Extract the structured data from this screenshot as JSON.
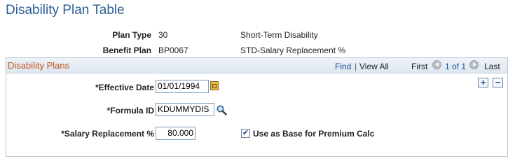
{
  "page": {
    "title": "Disability Plan Table"
  },
  "header": {
    "plan_type": {
      "label": "Plan Type",
      "code": "30",
      "description": "Short-Term Disability"
    },
    "benefit_plan": {
      "label": "Benefit Plan",
      "code": "BP0067",
      "description": "STD-Salary Replacement %"
    }
  },
  "section": {
    "title": "Disability Plans",
    "nav": {
      "find": "Find",
      "separator": "|",
      "view_all": "View All",
      "first": "First",
      "count": "1 of 1",
      "last": "Last"
    },
    "add_symbol": "+",
    "delete_symbol": "−"
  },
  "fields": {
    "effective_date": {
      "label": "*Effective Date",
      "value": "01/01/1994"
    },
    "formula_id": {
      "label": "*Formula ID",
      "value": "KDUMMYDIS"
    },
    "salary_replacement": {
      "label": "*Salary Replacement %",
      "value": "80.000"
    },
    "premium_base": {
      "label": "Use as Base for Premium Calc",
      "checked": true,
      "check_glyph": "✔"
    }
  },
  "icons": {
    "calendar": "calendar-icon",
    "search": "search-icon",
    "prev": "arrow-left-icon",
    "next": "arrow-right-icon"
  }
}
